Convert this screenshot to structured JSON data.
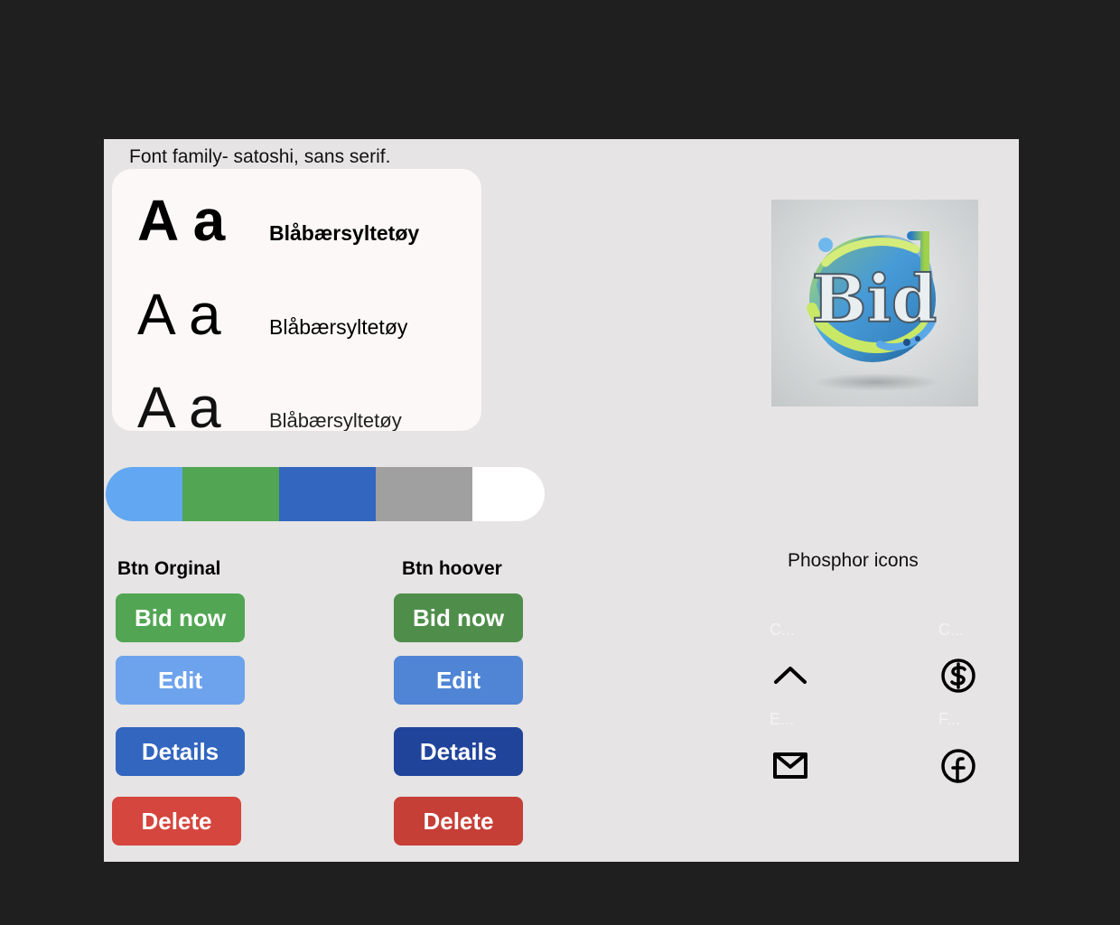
{
  "typography": {
    "title": "Font family- satoshi, sans serif.",
    "rows": [
      {
        "glyphs": "A a",
        "sample": "Blåbærsyltetøy"
      },
      {
        "glyphs": "A a",
        "sample": "Blåbærsyltetøy"
      },
      {
        "glyphs": "A a",
        "sample": "Blåbærsyltetøy"
      }
    ]
  },
  "palette": [
    {
      "color": "#62a7f1",
      "share": 0.175
    },
    {
      "color": "#52a653",
      "share": 0.22
    },
    {
      "color": "#3266bf",
      "share": 0.22
    },
    {
      "color": "#a0a0a0",
      "share": 0.22
    },
    {
      "color": "#ffffff",
      "share": 0.165
    }
  ],
  "buttons": {
    "original": {
      "heading": "Btn Orginal",
      "bid": {
        "label": "Bid now",
        "color": "#52a653"
      },
      "edit": {
        "label": "Edit",
        "color": "#6da3ec"
      },
      "details": {
        "label": "Details",
        "color": "#3266bf"
      },
      "delete": {
        "label": "Delete",
        "color": "#d5463e"
      }
    },
    "hover": {
      "heading": "Btn hoover",
      "bid": {
        "label": "Bid now",
        "color": "#4f8e4a"
      },
      "edit": {
        "label": "Edit",
        "color": "#4f85d4"
      },
      "details": {
        "label": "Details",
        "color": "#21449b"
      },
      "delete": {
        "label": "Delete",
        "color": "#c63f37"
      }
    }
  },
  "icons": {
    "title": "Phosphor icons",
    "items": [
      {
        "label": "C...",
        "icon": "caret-up-icon"
      },
      {
        "label": "C...",
        "icon": "currency-circle-dollar-icon"
      },
      {
        "label": "E...",
        "icon": "envelope-icon"
      },
      {
        "label": "F...",
        "icon": "facebook-logo-icon"
      }
    ]
  },
  "logo": {
    "text": "Bid",
    "icon": "bid-logo-3d"
  }
}
